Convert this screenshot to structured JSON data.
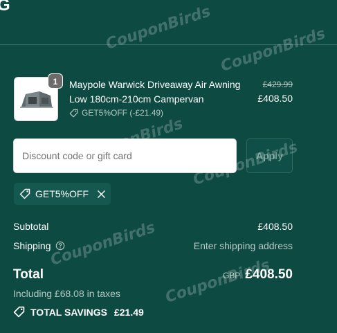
{
  "header": {
    "logo_fragment": "G"
  },
  "product": {
    "quantity": "1",
    "name": "Maypole Warwick Driveaway Air Awning Low 180cm-210cm Campervan",
    "discount_applied": "GET5%OFF (-£21.49)",
    "compare_at_price": "£429.99",
    "price": "£408.50",
    "thumbnail_icon": "awning-product-image"
  },
  "discount": {
    "placeholder": "Discount code or gift card",
    "apply_label": "Apply",
    "applied_code": "GET5%OFF"
  },
  "summary": {
    "subtotal_label": "Subtotal",
    "subtotal_value": "£408.50",
    "shipping_label": "Shipping",
    "shipping_value": "Enter shipping address",
    "total_label": "Total",
    "currency": "GBP",
    "total_value": "£408.50",
    "taxes_note": "Including £68.08 in taxes",
    "savings_label": "TOTAL SAVINGS",
    "savings_value": "£21.49"
  },
  "watermark": "CouponBirds",
  "colors": {
    "background": "#0d4a42",
    "text": "#ffffff",
    "muted_text": "#b5c9c5",
    "chip_bg": "#14584f"
  }
}
